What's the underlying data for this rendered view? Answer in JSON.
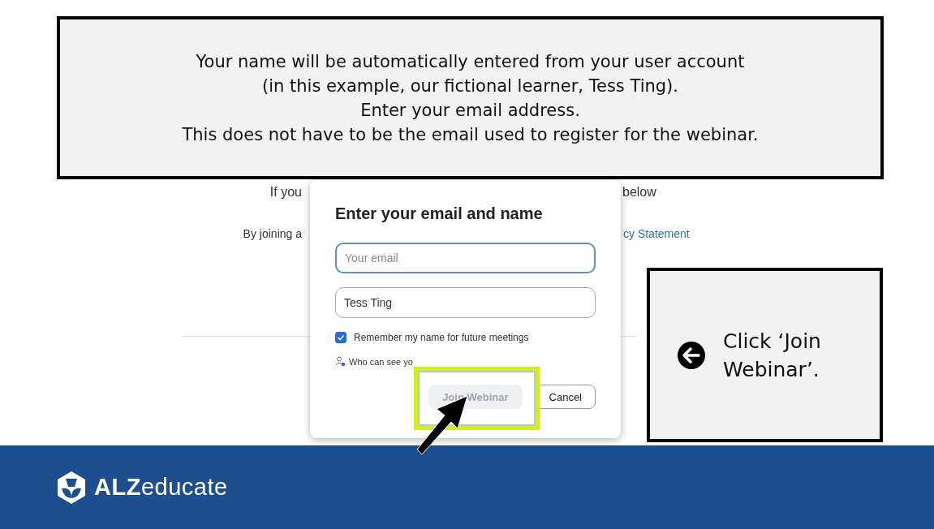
{
  "top_callout": {
    "lines": [
      "Your name will be automatically entered from your user account",
      "(in this example, our fictional learner, Tess Ting).",
      "Enter your email address.",
      "This does not have to be the email used to register for the webinar."
    ]
  },
  "background_page": {
    "line_1_left": "If you",
    "line_1_right": "below",
    "line_2_left": "By joining a",
    "line_2_link": "cy Statement"
  },
  "dialog": {
    "title": "Enter your email and name",
    "email": {
      "placeholder": "Your email",
      "focused": true
    },
    "name": {
      "value": "Tess Ting",
      "focused": false
    },
    "remember": {
      "label": "Remember my name for future meetings",
      "checked": true
    },
    "privacy_link": "Who can see yo",
    "buttons": [
      {
        "label": "Join Webinar",
        "disabled": true
      },
      {
        "label": "Cancel",
        "disabled": false
      }
    ]
  },
  "side_callout": {
    "text": "Click ‘Join Webinar’."
  },
  "footer": {
    "logo": "**ALZ**educate"
  }
}
